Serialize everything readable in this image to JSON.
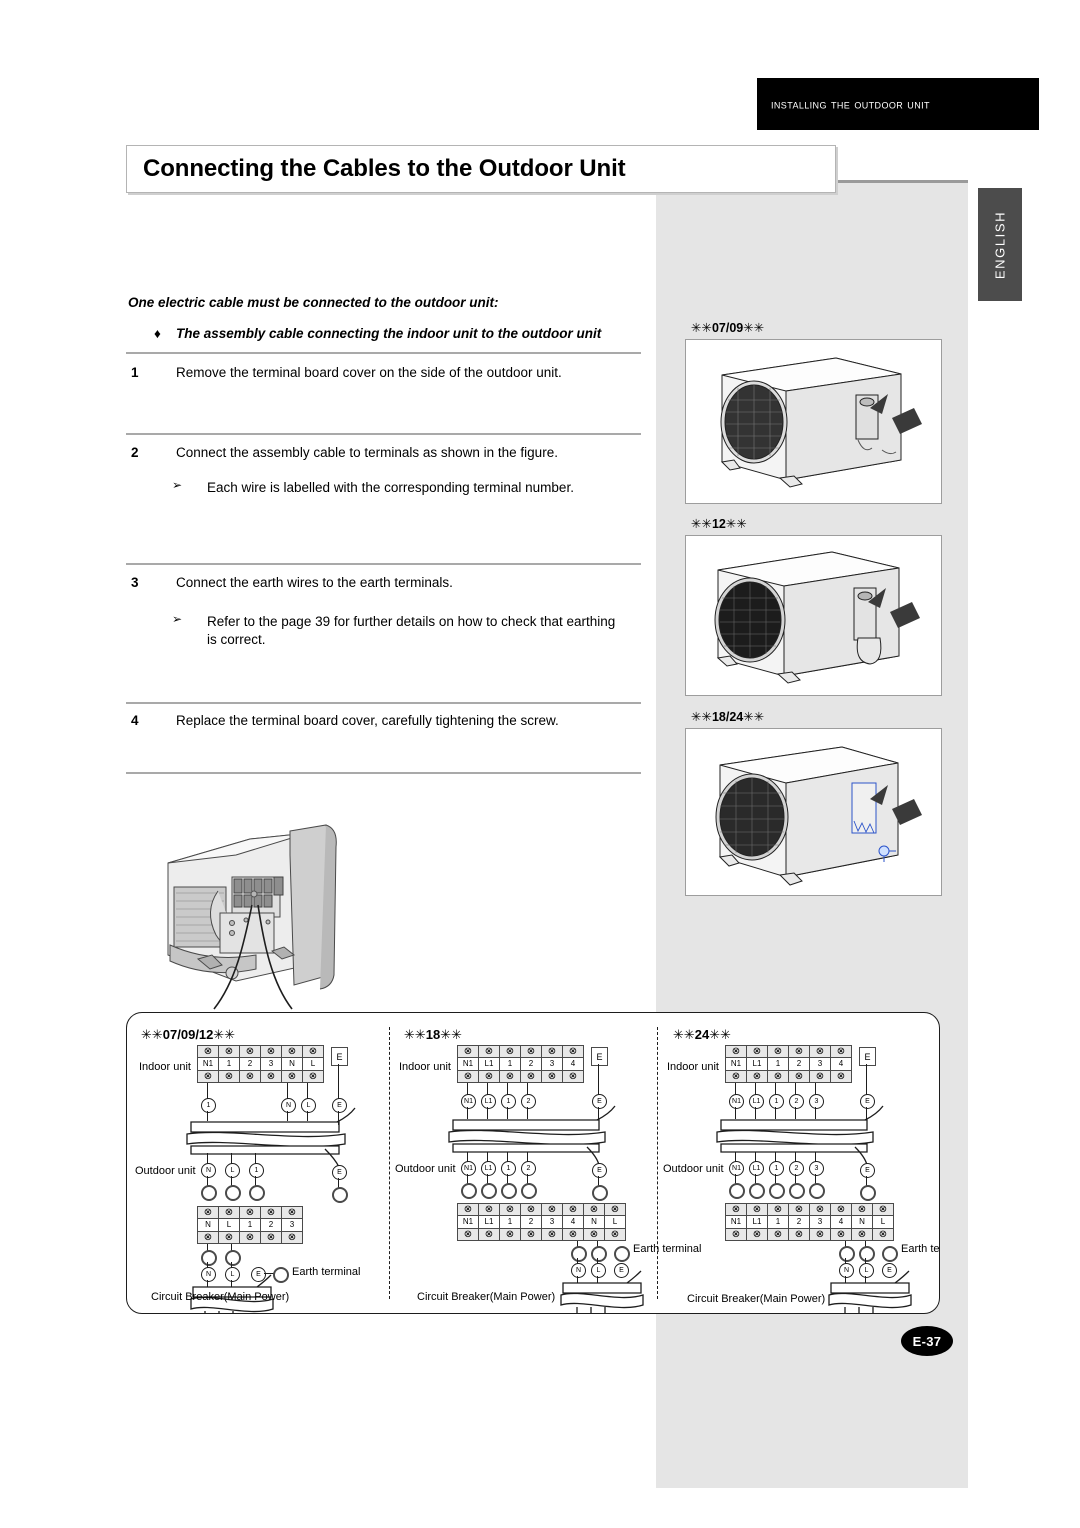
{
  "header": {
    "banner": "Installing the Outdoor Unit",
    "language_tab": "ENGLISH",
    "title": "Connecting the Cables to the Outdoor Unit"
  },
  "intro": {
    "lead": "One electric cable must be connected to the outdoor unit:",
    "bullet_glyph": "♦",
    "bullet": "The assembly cable connecting the indoor unit to the outdoor unit"
  },
  "steps": [
    {
      "num": "1",
      "text": "Remove the terminal board cover on the side of the outdoor unit.",
      "subs": []
    },
    {
      "num": "2",
      "text": "Connect the assembly cable to terminals as shown in the figure.",
      "subs": [
        "Each wire is labelled with the corresponding terminal number."
      ]
    },
    {
      "num": "3",
      "text": "Connect the earth wires to the earth terminals.",
      "subs": [
        "Refer to the page 39 for further details on how to check that earthing is correct."
      ]
    },
    {
      "num": "4",
      "text": "Replace the terminal board cover, carefully tightening the screw.",
      "subs": []
    }
  ],
  "sub_arrow": "➢",
  "unit_panels": [
    {
      "label": "✳✳07/09✳✳"
    },
    {
      "label": "✳✳12✳✳"
    },
    {
      "label": "✳✳18/24✳✳"
    }
  ],
  "diagram_labels": {
    "indoor": "Indoor unit",
    "outdoor": "Outdoor unit",
    "earth": "Earth terminal",
    "earth_l1": "Earth",
    "earth_l2": "terminal",
    "breaker": "Circuit Breaker(Main Power)",
    "screw_glyph": "⊗",
    "e_label": "E"
  },
  "chart_data": {
    "type": "table",
    "title": "Outdoor unit cable connection wiring diagrams",
    "diagrams": [
      {
        "title": "✳✳07/09/12✳✳",
        "indoor_terminals": [
          "N1",
          "1",
          "2",
          "3",
          "N",
          "L"
        ],
        "indoor_earth": "E",
        "indoor_wire_tags": [
          "1",
          "N",
          "L",
          "E"
        ],
        "outdoor_wire_tags": [
          "N",
          "L",
          "1",
          "E"
        ],
        "outdoor_terminals": [
          "N",
          "L",
          "1",
          "2",
          "3"
        ],
        "breaker_tags": [
          "N",
          "L",
          "E"
        ],
        "earth_label": "Earth terminal",
        "breaker_label": "Circuit Breaker(Main Power)"
      },
      {
        "title": "✳✳18✳✳",
        "indoor_terminals": [
          "N1",
          "L1",
          "1",
          "2",
          "3",
          "4"
        ],
        "indoor_earth": "E",
        "indoor_wire_tags": [
          "N1",
          "L1",
          "1",
          "2",
          "E"
        ],
        "outdoor_wire_tags": [
          "N1",
          "L1",
          "1",
          "2",
          "E"
        ],
        "outdoor_terminals": [
          "N1",
          "L1",
          "1",
          "2",
          "3",
          "4",
          "N",
          "L"
        ],
        "breaker_tags": [
          "N",
          "L",
          "E"
        ],
        "earth_label": "Earth terminal",
        "breaker_label": "Circuit Breaker(Main Power)"
      },
      {
        "title": "✳✳24✳✳",
        "indoor_terminals": [
          "N1",
          "L1",
          "1",
          "2",
          "3",
          "4"
        ],
        "indoor_earth": "E",
        "indoor_wire_tags": [
          "N1",
          "L1",
          "1",
          "2",
          "3",
          "E"
        ],
        "outdoor_wire_tags": [
          "N1",
          "L1",
          "1",
          "2",
          "3",
          "E"
        ],
        "outdoor_terminals": [
          "N1",
          "L1",
          "1",
          "2",
          "3",
          "4",
          "N",
          "L"
        ],
        "breaker_tags": [
          "N",
          "L",
          "E"
        ],
        "earth_label": "Earth terminal",
        "breaker_label": "Circuit Breaker(Main Power)"
      }
    ]
  },
  "footer": {
    "page": "E-37"
  }
}
